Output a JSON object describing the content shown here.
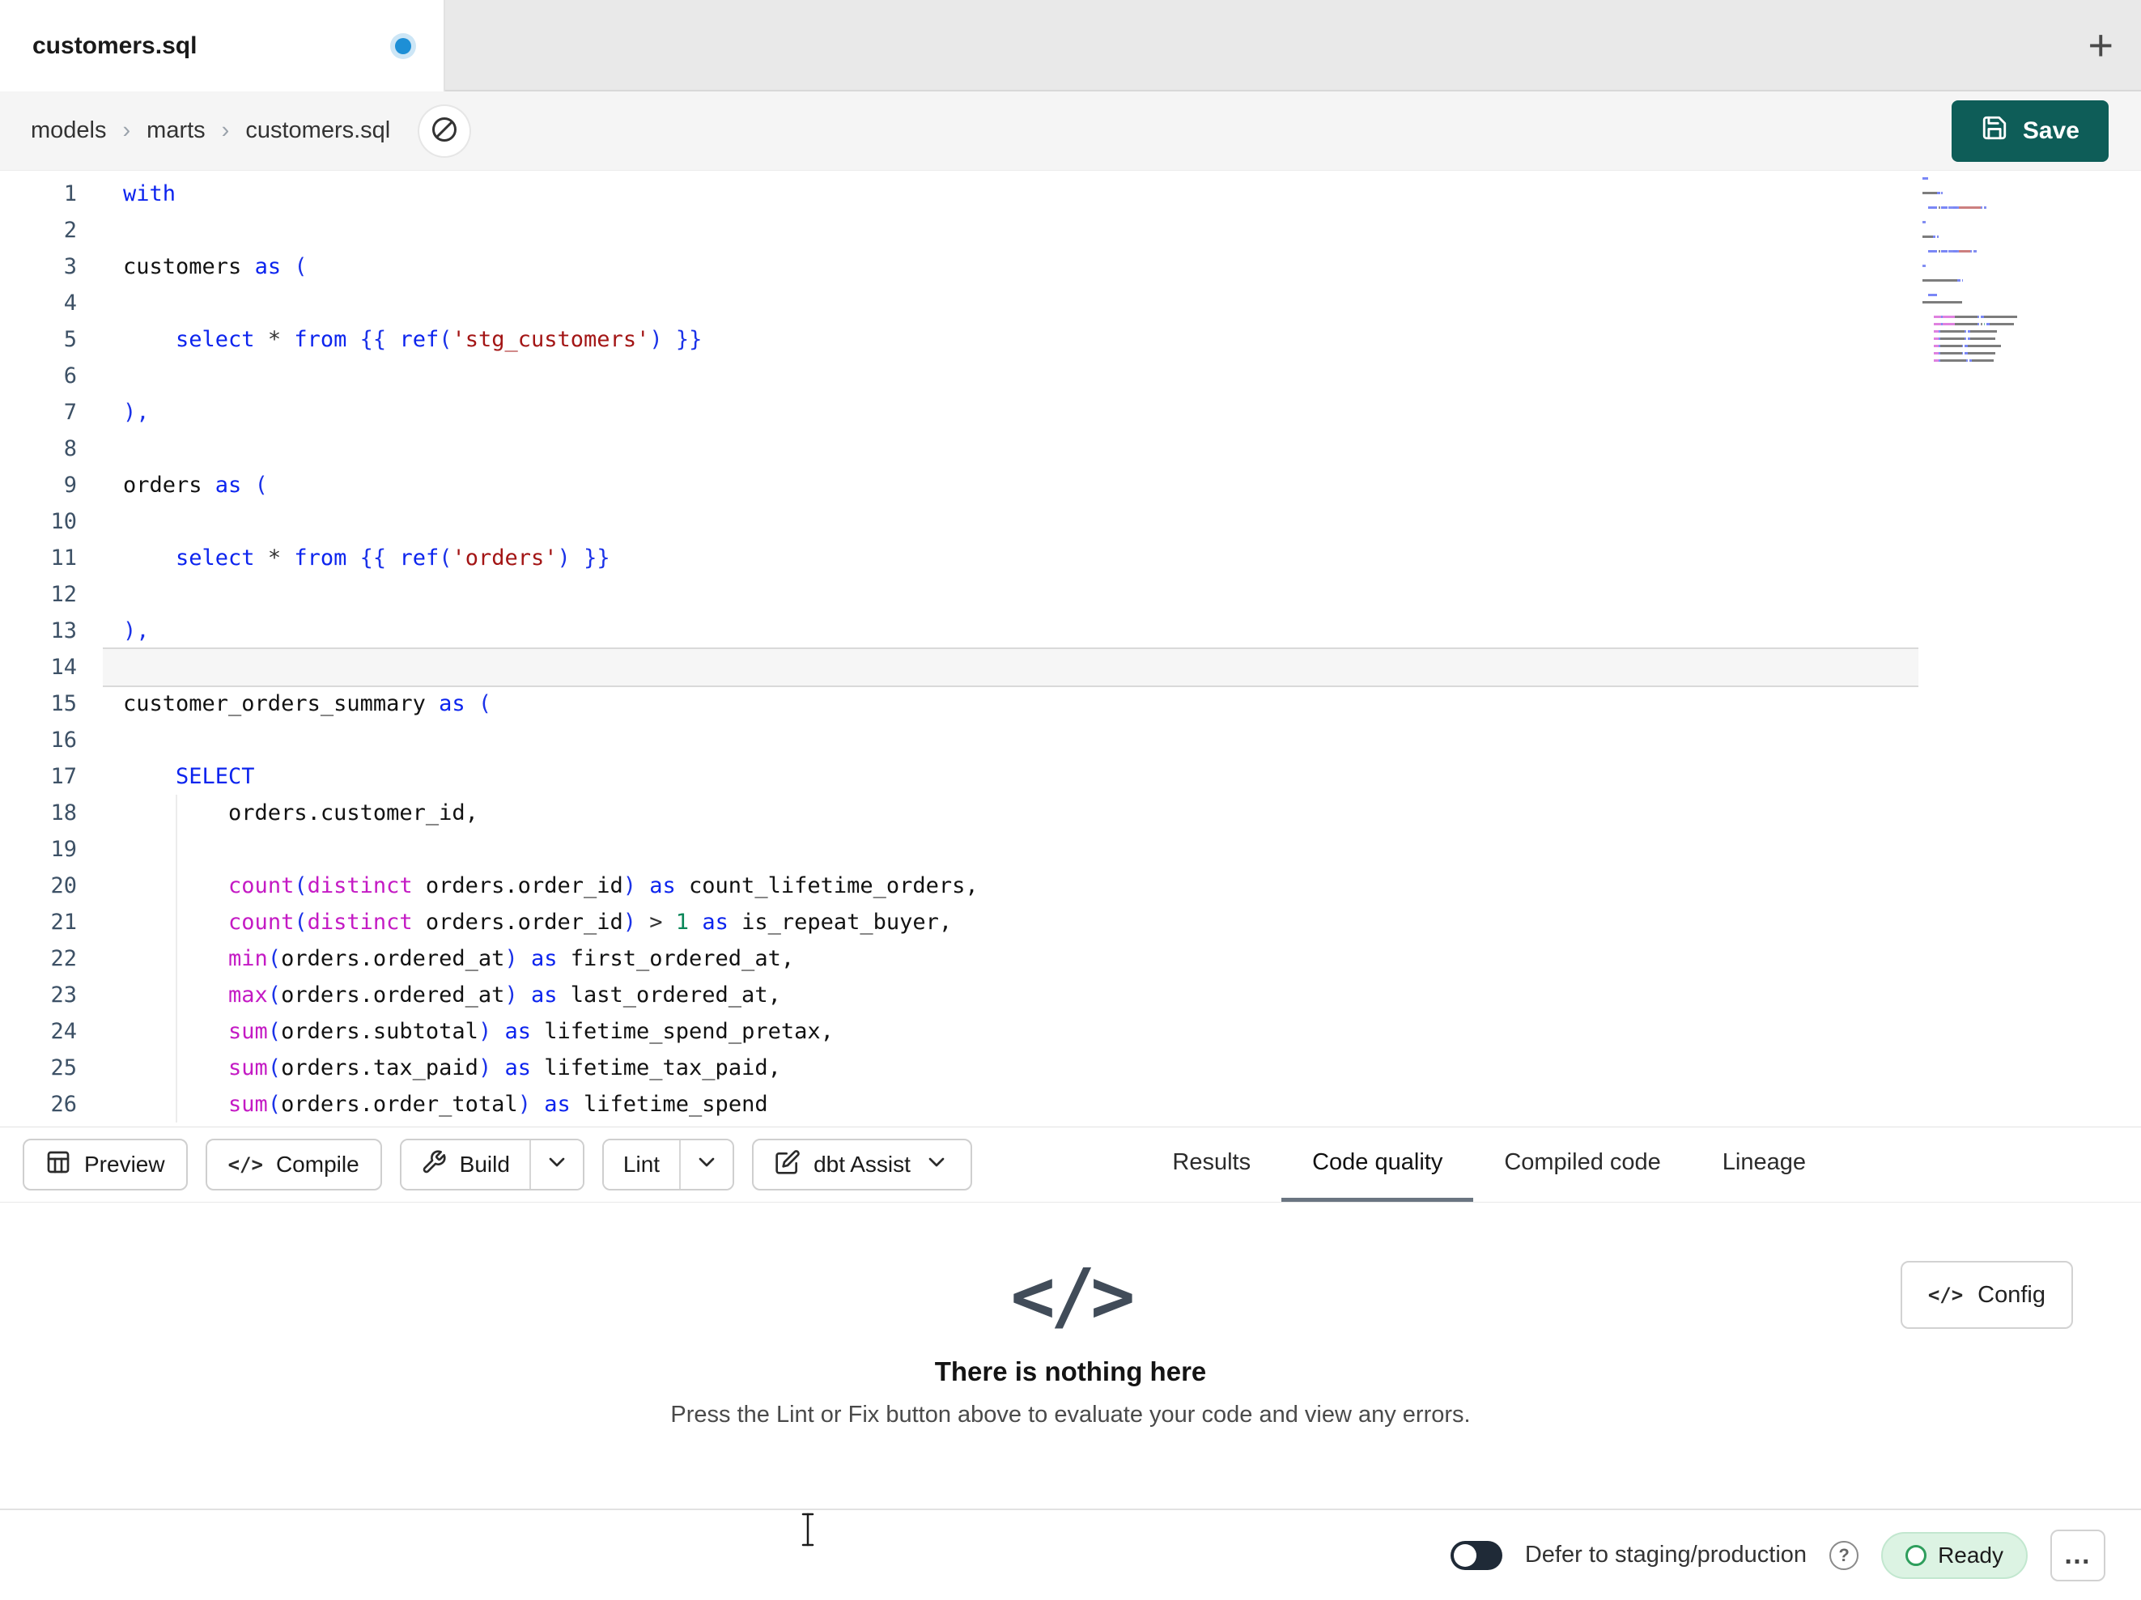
{
  "window": {
    "tab_title": "customers.sql",
    "new_tab_icon": "+"
  },
  "breadcrumb": {
    "items": [
      "models",
      "marts",
      "customers.sql"
    ],
    "separator": "›"
  },
  "header": {
    "save_label": "Save"
  },
  "editor": {
    "current_line": 14,
    "lines": [
      {
        "n": 1,
        "t": [
          [
            "kw",
            "with"
          ]
        ]
      },
      {
        "n": 2,
        "t": []
      },
      {
        "n": 3,
        "t": [
          [
            "id",
            "customers "
          ],
          [
            "kw",
            "as"
          ],
          [
            "id",
            " "
          ],
          [
            "pn",
            "("
          ]
        ]
      },
      {
        "n": 4,
        "t": []
      },
      {
        "n": 5,
        "t": [
          [
            "id",
            "    "
          ],
          [
            "kw",
            "select"
          ],
          [
            "id",
            " "
          ],
          [
            "op",
            "*"
          ],
          [
            "id",
            " "
          ],
          [
            "kw",
            "from"
          ],
          [
            "id",
            " "
          ],
          [
            "pn",
            "{{ "
          ],
          [
            "kw",
            "ref"
          ],
          [
            "pn",
            "("
          ],
          [
            "str",
            "'stg_customers'"
          ],
          [
            "pn",
            ")"
          ],
          [
            "id",
            " "
          ],
          [
            "pn",
            "}}"
          ]
        ]
      },
      {
        "n": 6,
        "t": []
      },
      {
        "n": 7,
        "t": [
          [
            "pn",
            "),"
          ]
        ]
      },
      {
        "n": 8,
        "t": []
      },
      {
        "n": 9,
        "t": [
          [
            "id",
            "orders "
          ],
          [
            "kw",
            "as"
          ],
          [
            "id",
            " "
          ],
          [
            "pn",
            "("
          ]
        ]
      },
      {
        "n": 10,
        "t": []
      },
      {
        "n": 11,
        "t": [
          [
            "id",
            "    "
          ],
          [
            "kw",
            "select"
          ],
          [
            "id",
            " "
          ],
          [
            "op",
            "*"
          ],
          [
            "id",
            " "
          ],
          [
            "kw",
            "from"
          ],
          [
            "id",
            " "
          ],
          [
            "pn",
            "{{ "
          ],
          [
            "kw",
            "ref"
          ],
          [
            "pn",
            "("
          ],
          [
            "str",
            "'orders'"
          ],
          [
            "pn",
            ")"
          ],
          [
            "id",
            " "
          ],
          [
            "pn",
            "}}"
          ]
        ]
      },
      {
        "n": 12,
        "t": []
      },
      {
        "n": 13,
        "t": [
          [
            "pn",
            "),"
          ]
        ]
      },
      {
        "n": 14,
        "t": []
      },
      {
        "n": 15,
        "t": [
          [
            "id",
            "customer_orders_summary "
          ],
          [
            "kw",
            "as"
          ],
          [
            "id",
            " "
          ],
          [
            "pn",
            "("
          ]
        ]
      },
      {
        "n": 16,
        "t": []
      },
      {
        "n": 17,
        "t": [
          [
            "id",
            "    "
          ],
          [
            "kw",
            "SELECT"
          ]
        ]
      },
      {
        "n": 18,
        "t": [
          [
            "id",
            "        orders.customer_id,"
          ]
        ]
      },
      {
        "n": 19,
        "t": []
      },
      {
        "n": 20,
        "t": [
          [
            "id",
            "        "
          ],
          [
            "fn",
            "count"
          ],
          [
            "pn",
            "("
          ],
          [
            "fn",
            "distinct"
          ],
          [
            "id",
            " orders.order_id"
          ],
          [
            "pn",
            ")"
          ],
          [
            "id",
            " "
          ],
          [
            "kw",
            "as"
          ],
          [
            "id",
            " count_lifetime_orders,"
          ]
        ]
      },
      {
        "n": 21,
        "t": [
          [
            "id",
            "        "
          ],
          [
            "fn",
            "count"
          ],
          [
            "pn",
            "("
          ],
          [
            "fn",
            "distinct"
          ],
          [
            "id",
            " orders.order_id"
          ],
          [
            "pn",
            ")"
          ],
          [
            "id",
            " "
          ],
          [
            "op",
            ">"
          ],
          [
            "id",
            " "
          ],
          [
            "num",
            "1"
          ],
          [
            "id",
            " "
          ],
          [
            "kw",
            "as"
          ],
          [
            "id",
            " is_repeat_buyer,"
          ]
        ]
      },
      {
        "n": 22,
        "t": [
          [
            "id",
            "        "
          ],
          [
            "fn",
            "min"
          ],
          [
            "pn",
            "("
          ],
          [
            "id",
            "orders.ordered_at"
          ],
          [
            "pn",
            ")"
          ],
          [
            "id",
            " "
          ],
          [
            "kw",
            "as"
          ],
          [
            "id",
            " first_ordered_at,"
          ]
        ]
      },
      {
        "n": 23,
        "t": [
          [
            "id",
            "        "
          ],
          [
            "fn",
            "max"
          ],
          [
            "pn",
            "("
          ],
          [
            "id",
            "orders.ordered_at"
          ],
          [
            "pn",
            ")"
          ],
          [
            "id",
            " "
          ],
          [
            "kw",
            "as"
          ],
          [
            "id",
            " last_ordered_at,"
          ]
        ]
      },
      {
        "n": 24,
        "t": [
          [
            "id",
            "        "
          ],
          [
            "fn",
            "sum"
          ],
          [
            "pn",
            "("
          ],
          [
            "id",
            "orders.subtotal"
          ],
          [
            "pn",
            ")"
          ],
          [
            "id",
            " "
          ],
          [
            "kw",
            "as"
          ],
          [
            "id",
            " lifetime_spend_pretax,"
          ]
        ]
      },
      {
        "n": 25,
        "t": [
          [
            "id",
            "        "
          ],
          [
            "fn",
            "sum"
          ],
          [
            "pn",
            "("
          ],
          [
            "id",
            "orders.tax_paid"
          ],
          [
            "pn",
            ")"
          ],
          [
            "id",
            " "
          ],
          [
            "kw",
            "as"
          ],
          [
            "id",
            " lifetime_tax_paid,"
          ]
        ]
      },
      {
        "n": 26,
        "t": [
          [
            "id",
            "        "
          ],
          [
            "fn",
            "sum"
          ],
          [
            "pn",
            "("
          ],
          [
            "id",
            "orders.order_total"
          ],
          [
            "pn",
            ")"
          ],
          [
            "id",
            " "
          ],
          [
            "kw",
            "as"
          ],
          [
            "id",
            " lifetime_spend"
          ]
        ]
      }
    ]
  },
  "toolbar": {
    "preview_label": "Preview",
    "compile_label": "Compile",
    "compile_glyph": "</>",
    "build_label": "Build",
    "lint_label": "Lint",
    "assist_label": "dbt Assist"
  },
  "panel": {
    "tabs": [
      {
        "label": "Results",
        "active": false
      },
      {
        "label": "Code quality",
        "active": true
      },
      {
        "label": "Compiled code",
        "active": false
      },
      {
        "label": "Lineage",
        "active": false
      }
    ],
    "empty_icon": "</>",
    "empty_title": "There is nothing here",
    "empty_subtitle": "Press the Lint or Fix button above to evaluate your code and view any errors.",
    "config_glyph": "</>",
    "config_label": "Config"
  },
  "status_bar": {
    "defer_label": "Defer to staging/production",
    "help_glyph": "?",
    "ready_label": "Ready",
    "more_glyph": "…"
  },
  "colors": {
    "save_button_bg": "#0e5d58",
    "unsaved_dot": "#1d8fd6",
    "keyword": "#0c24ee",
    "function": "#c41ac4",
    "string": "#a31515",
    "number": "#098658",
    "punctuation": "#1b32e8",
    "operator": "#333333",
    "text_color": "#121212",
    "line_number": "#3d5166",
    "current_line_border": "#d9d9d9",
    "active_tab_underline": "#6a7581",
    "ready_bg": "#dcf3e3",
    "ready_border": "#c2e7cf",
    "ready_ring": "#2e9e5c"
  }
}
